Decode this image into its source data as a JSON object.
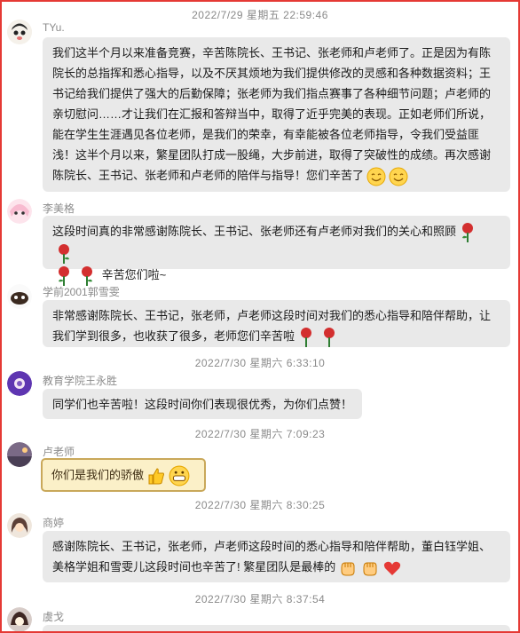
{
  "messages": [
    {
      "time": "2022/7/29 星期五 22:59:46",
      "sender": "TYu.",
      "text": "我们这半个月以来准备竞赛，辛苦陈院长、王书记、张老师和卢老师了。正是因为有陈院长的总指挥和悉心指导，以及不厌其烦地为我们提供修改的灵感和各种数据资料；王书记给我们提供了强大的后勤保障；张老师为我们指点赛事了各种细节问题；卢老师的亲切慰问……才让我们在汇报和答辩当中，取得了近乎完美的表现。正如老师们所说，能在学生生涯遇见各位老师，是我们的荣幸，有幸能被各位老师指导，令我们受益匪浅！这半个月以来，繁星团队打成一股绳，大步前进，取得了突破性的成绩。再次感谢陈院长、王书记、张老师和卢老师的陪伴与指导！您们辛苦了"
    },
    {
      "sender": "李美格",
      "text": "这段时间真的非常感谢陈院长、王书记、张老师还有卢老师对我们的关心和照顾",
      "text2": "辛苦您们啦~"
    },
    {
      "sender": "学前2001郭雪雯",
      "text": "非常感谢陈院长、王书记，张老师，卢老师这段时间对我们的悉心指导和陪伴帮助，让我们学到很多，也收获了很多，老师您们辛苦啦"
    },
    {
      "time": "2022/7/30 星期六 6:33:10",
      "sender": "教育学院王永胜",
      "text": "同学们也辛苦啦！这段时间你们表现很优秀，为你们点赞！"
    },
    {
      "time": "2022/7/30 星期六 7:09:23",
      "sender": "卢老师",
      "text": "你们是我们的骄傲"
    },
    {
      "time": "2022/7/30 星期六 8:30:25",
      "sender": "商婷",
      "text": "感谢陈院长、王书记，张老师，卢老师这段时间的悉心指导和陪伴帮助，董白钰学姐、美格学姐和雪雯儿这段时间也辛苦了! 繁星团队是最棒的"
    },
    {
      "time": "2022/7/30 星期六 8:37:54",
      "sender": "虞戈"
    }
  ]
}
